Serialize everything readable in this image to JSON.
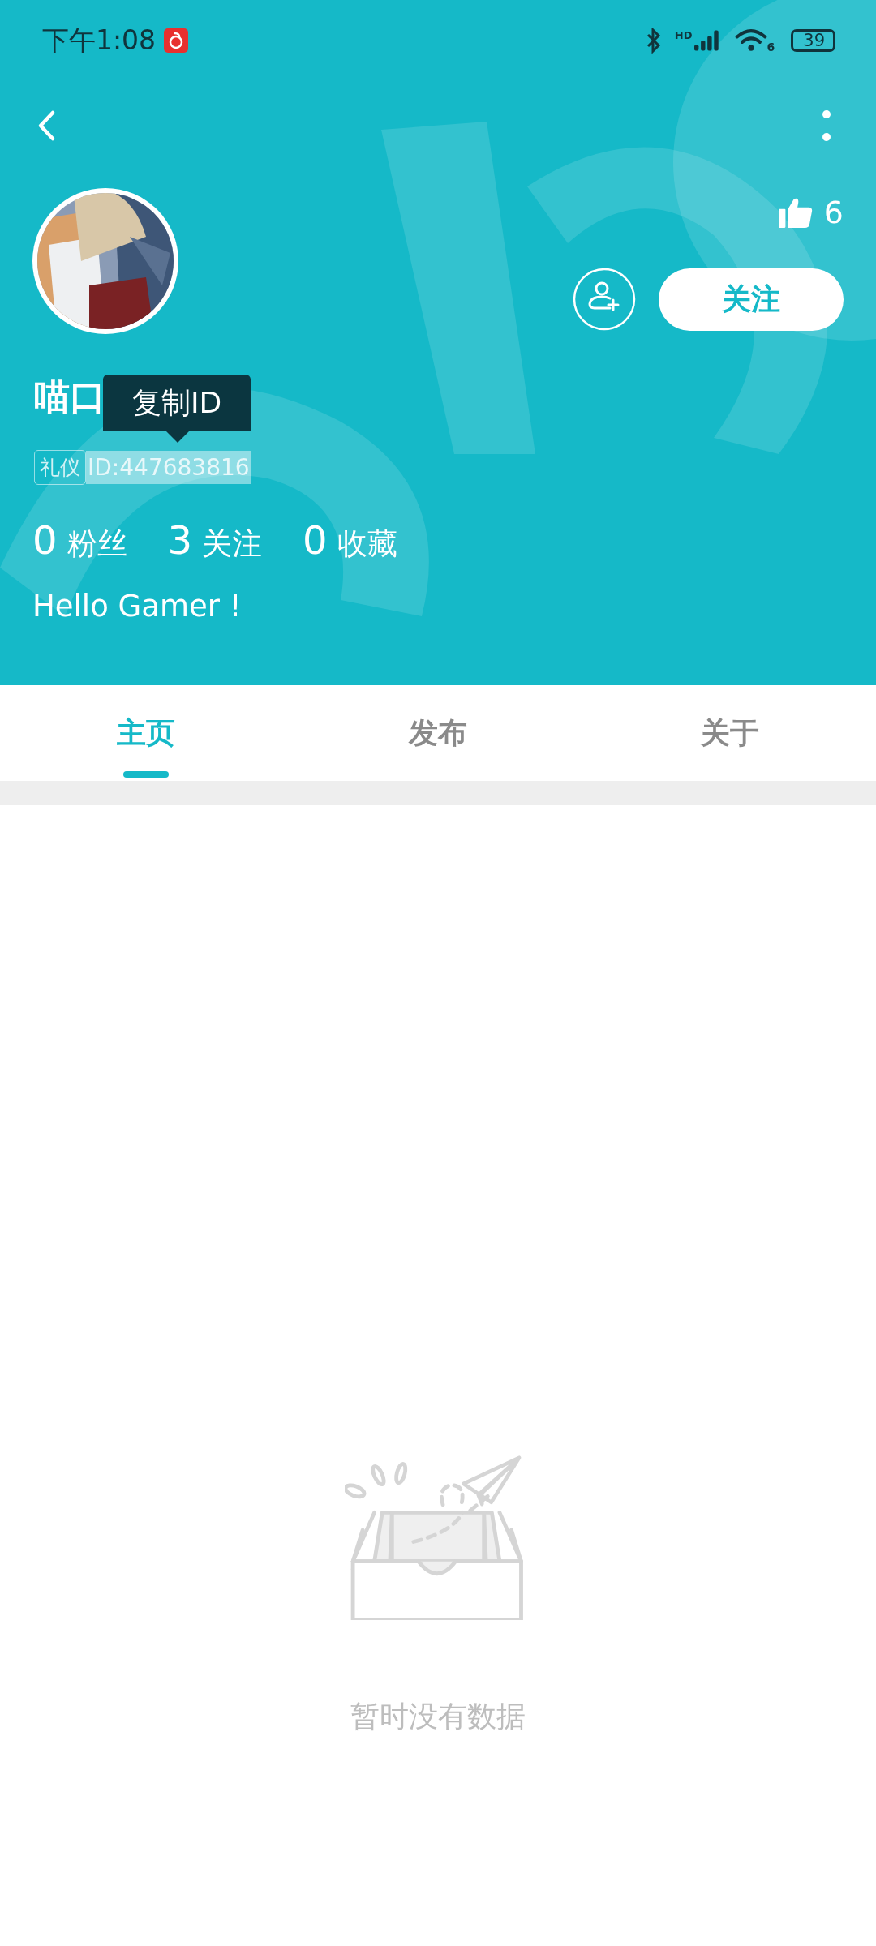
{
  "status_bar": {
    "time": "下午1:08",
    "network_badge": "HD",
    "wifi_badge": "6",
    "battery": "39"
  },
  "likes": "6",
  "follow_button": "关注",
  "profile": {
    "name": "喵口",
    "tooltip": "复制ID",
    "tag": "礼仪",
    "id": "ID:447683816",
    "id_selected": true,
    "bio": "Hello Gamer !"
  },
  "stats": [
    {
      "count": "0",
      "label": "粉丝"
    },
    {
      "count": "3",
      "label": "关注"
    },
    {
      "count": "0",
      "label": "收藏"
    }
  ],
  "tabs": [
    {
      "label": "主页",
      "selected": true
    },
    {
      "label": "发布",
      "selected": false
    },
    {
      "label": "关于",
      "selected": false
    }
  ],
  "empty_state": {
    "message": "暂时没有数据"
  }
}
